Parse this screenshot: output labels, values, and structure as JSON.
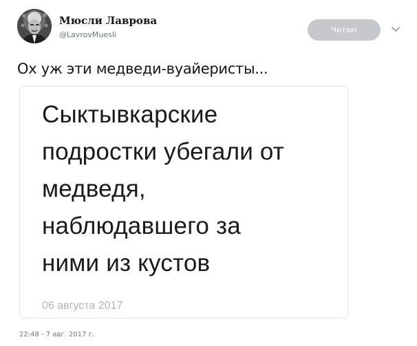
{
  "author": {
    "display_name": "Мюсли Лаврова",
    "handle": "@LavrovMuesli"
  },
  "header": {
    "follow_label": "Читаю"
  },
  "tweet": {
    "text": "Ох уж эти медведи-вуайеристы...",
    "timestamp": "22:48 - 7 авг. 2017 г."
  },
  "card": {
    "headline_lines": [
      "Сыктывкарские",
      "подростки убегали от",
      "медведя,",
      "наблюдавшего за",
      "ними из кустов"
    ],
    "date": "06 августа 2017"
  },
  "icons": {
    "avatar": "avatar-portrait",
    "caret": "chevron-down-icon"
  },
  "colors": {
    "follow_button_bg": "#c6c9cc",
    "secondary_text": "#657786",
    "card_border": "#e1e8ed",
    "card_date": "#b4b4b4"
  }
}
